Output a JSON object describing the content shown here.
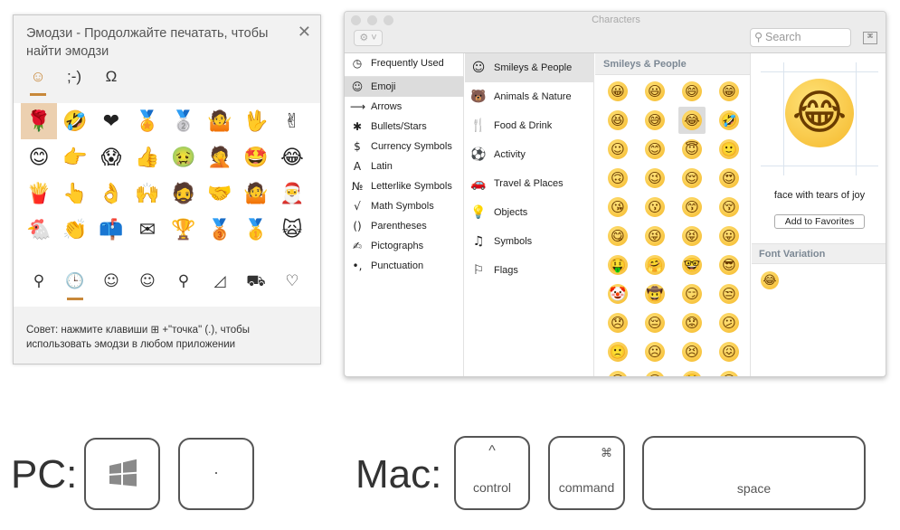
{
  "windows_panel": {
    "title": "Эмодзи - Продолжайте печатать, чтобы найти эмодзи",
    "close_icon": "✕",
    "tabs": [
      "☺",
      ";-)",
      "Ω"
    ],
    "emoji_rows": [
      [
        "🌹",
        "🤣",
        "❤",
        "🏅",
        "🥈",
        "🤷",
        "🖖",
        "✌"
      ],
      [
        "😊",
        "👉",
        "😱",
        "👍",
        "🤢",
        "🤦",
        "🤩",
        "😂"
      ],
      [
        "🍟",
        "👆",
        "👌",
        "🙌",
        "🧔",
        "🤝",
        "🤷",
        "🎅"
      ],
      [
        "🐔",
        "👏",
        "📫",
        "✉",
        "🏆",
        "🥉",
        "🥇",
        "🙀"
      ]
    ],
    "nav_icons": [
      "⚲",
      "🕒",
      "☺",
      "☺",
      "⚲",
      "◿",
      "⛟",
      "♡"
    ],
    "nav_names": [
      "search",
      "recent",
      "smileys",
      "people",
      "celebration",
      "food",
      "travel",
      "symbols"
    ],
    "tip_line1": "Совет: нажмите клавиши  ⊞ +\"точка\" (.), чтобы",
    "tip_line2": "использовать эмодзи в любом приложении",
    "accent": "#c8883a"
  },
  "mac_window": {
    "title": "Characters",
    "search_placeholder": "Search",
    "categories": [
      {
        "icon": "◷",
        "label": "Frequently Used"
      },
      {
        "icon": "☺",
        "label": "Emoji"
      },
      {
        "icon": "⟶",
        "label": "Arrows"
      },
      {
        "icon": "✱",
        "label": "Bullets/Stars"
      },
      {
        "icon": "$",
        "label": "Currency Symbols"
      },
      {
        "icon": "A",
        "label": "Latin"
      },
      {
        "icon": "№",
        "label": "Letterlike Symbols"
      },
      {
        "icon": "√",
        "label": "Math Symbols"
      },
      {
        "icon": "()",
        "label": "Parentheses"
      },
      {
        "icon": "✍",
        "label": "Pictographs"
      },
      {
        "icon": "•,",
        "label": "Punctuation"
      }
    ],
    "subcategories": [
      {
        "icon": "☺",
        "label": "Smileys & People"
      },
      {
        "icon": "🐻",
        "label": "Animals & Nature"
      },
      {
        "icon": "🍴",
        "label": "Food & Drink"
      },
      {
        "icon": "⚽",
        "label": "Activity"
      },
      {
        "icon": "🚗",
        "label": "Travel & Places"
      },
      {
        "icon": "💡",
        "label": "Objects"
      },
      {
        "icon": "♫",
        "label": "Symbols"
      },
      {
        "icon": "⚐",
        "label": "Flags"
      }
    ],
    "grid_header": "Smileys & People",
    "grid": [
      [
        "😀",
        "😃",
        "😄",
        "😁"
      ],
      [
        "😆",
        "😅",
        "😂",
        "🤣"
      ],
      [
        "☺",
        "😊",
        "😇",
        "🙂"
      ],
      [
        "🙃",
        "😉",
        "😌",
        "😍"
      ],
      [
        "😘",
        "😗",
        "😙",
        "😚"
      ],
      [
        "😋",
        "😜",
        "😝",
        "😛"
      ],
      [
        "🤑",
        "🤗",
        "🤓",
        "😎"
      ],
      [
        "🤡",
        "🤠",
        "😏",
        "😒"
      ],
      [
        "😞",
        "😔",
        "😟",
        "😕"
      ],
      [
        "🙁",
        "☹",
        "😣",
        "😖"
      ],
      [
        "😫",
        "😩",
        "😤",
        "😠"
      ]
    ],
    "selected_char": "😂",
    "selected_name": "face with tears of joy",
    "add_favorites": "Add to Favorites",
    "font_variation_header": "Font Variation"
  },
  "shortcuts": {
    "pc_label": "PC:",
    "pc_key2": "·",
    "mac_label": "Mac:",
    "control_symbol": "^",
    "control_label": "control",
    "command_symbol": "⌘",
    "command_label": "command",
    "space_label": "space"
  }
}
